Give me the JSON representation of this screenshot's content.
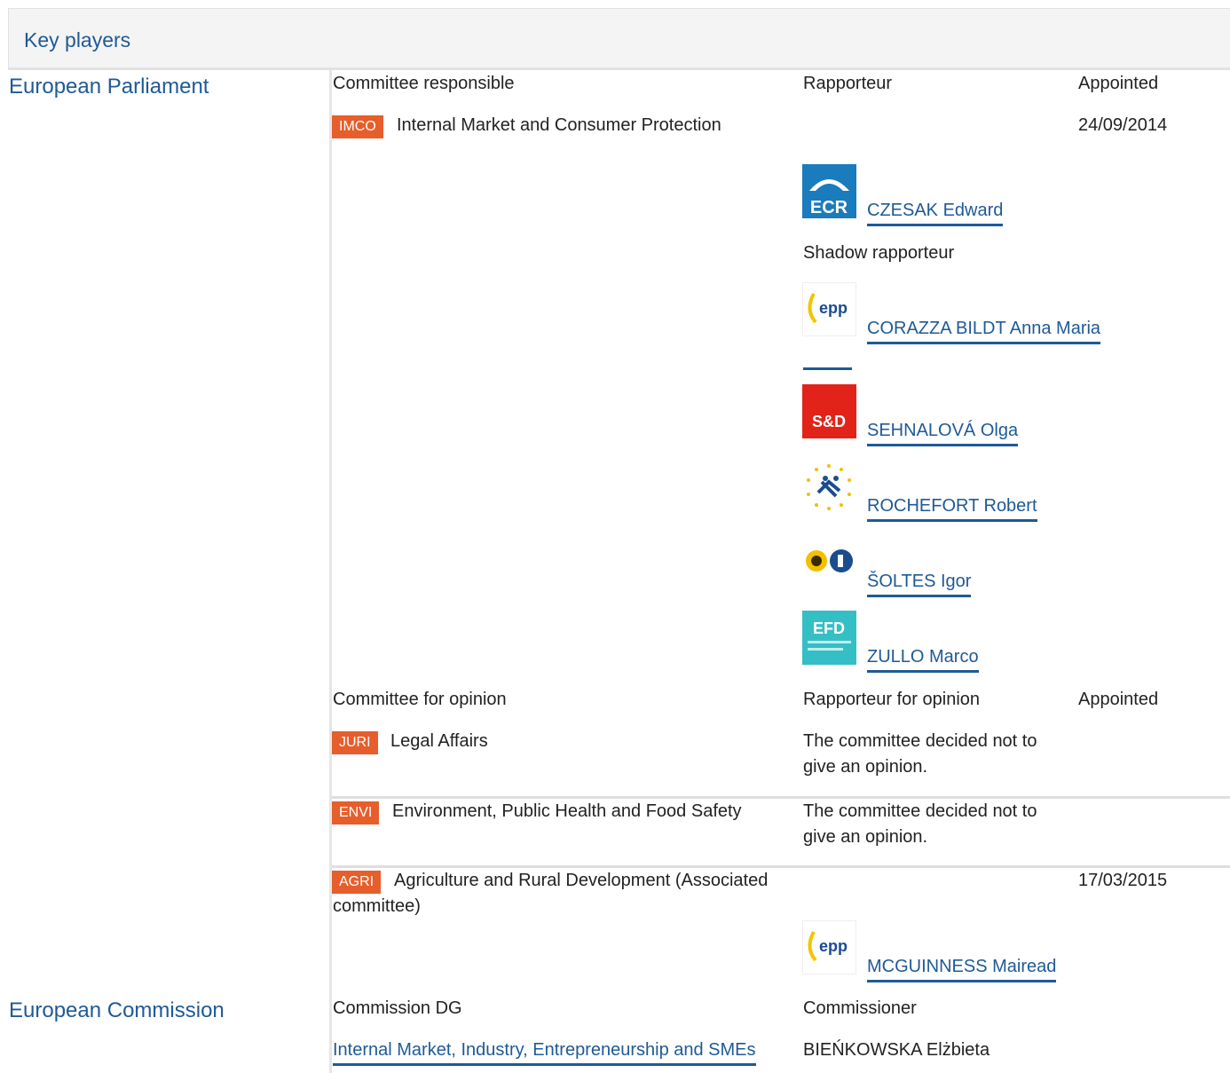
{
  "section_title": "Key players",
  "ep": {
    "label": "European Parliament",
    "committee_responsible": {
      "col_committee": "Committee responsible",
      "col_rapporteur": "Rapporteur",
      "col_appointed": "Appointed",
      "committee": {
        "code": "IMCO",
        "name": "Internal Market and Consumer Protection",
        "appointed": "24/09/2014"
      },
      "rapporteur": {
        "name": "CZESAK Edward",
        "group_logo": "ecr-logo"
      },
      "shadow_label": "Shadow rapporteur",
      "shadows": [
        {
          "name": "CORAZZA BILDT Anna Maria",
          "group_logo": "epp-logo"
        },
        {
          "name": "SEHNALOVÁ Olga",
          "group_logo": "sd-logo"
        },
        {
          "name": "ROCHEFORT Robert",
          "group_logo": "alde-logo"
        },
        {
          "name": "ŠOLTES Igor",
          "group_logo": "greens-logo"
        },
        {
          "name": "ZULLO Marco",
          "group_logo": "efd-logo"
        }
      ]
    },
    "opinion": {
      "col_committee": "Committee for opinion",
      "col_rapporteur": "Rapporteur for opinion",
      "col_appointed": "Appointed",
      "rows": [
        {
          "code": "JURI",
          "name": "Legal Affairs",
          "rapporteur": "The committee decided not to give an opinion.",
          "appointed": ""
        },
        {
          "code": "ENVI",
          "name": "Environment, Public Health and Food Safety",
          "rapporteur": "The committee decided not to give an opinion.",
          "appointed": ""
        },
        {
          "code": "AGRI",
          "name": "Agriculture and Rural Development (Associated committee)",
          "rapporteur": "MCGUINNESS Mairead",
          "group_logo": "epp-logo",
          "appointed": "17/03/2015"
        }
      ]
    }
  },
  "ec": {
    "label": "European Commission",
    "col_dg": "Commission DG",
    "col_commissioner": "Commissioner",
    "dg": "Internal Market, Industry, Entrepreneurship and SMEs",
    "commissioner": "BIEŃKOWSKA Elżbieta"
  },
  "logo_text": {
    "ecr": "ECR",
    "epp": "epp",
    "sd": "S&D",
    "efd": "EFD"
  },
  "colors": {
    "link": "#1f5a96",
    "badge": "#e65e2b",
    "ecr": "#1a7bbd",
    "sd": "#e2231a",
    "efd": "#34bfc5"
  }
}
